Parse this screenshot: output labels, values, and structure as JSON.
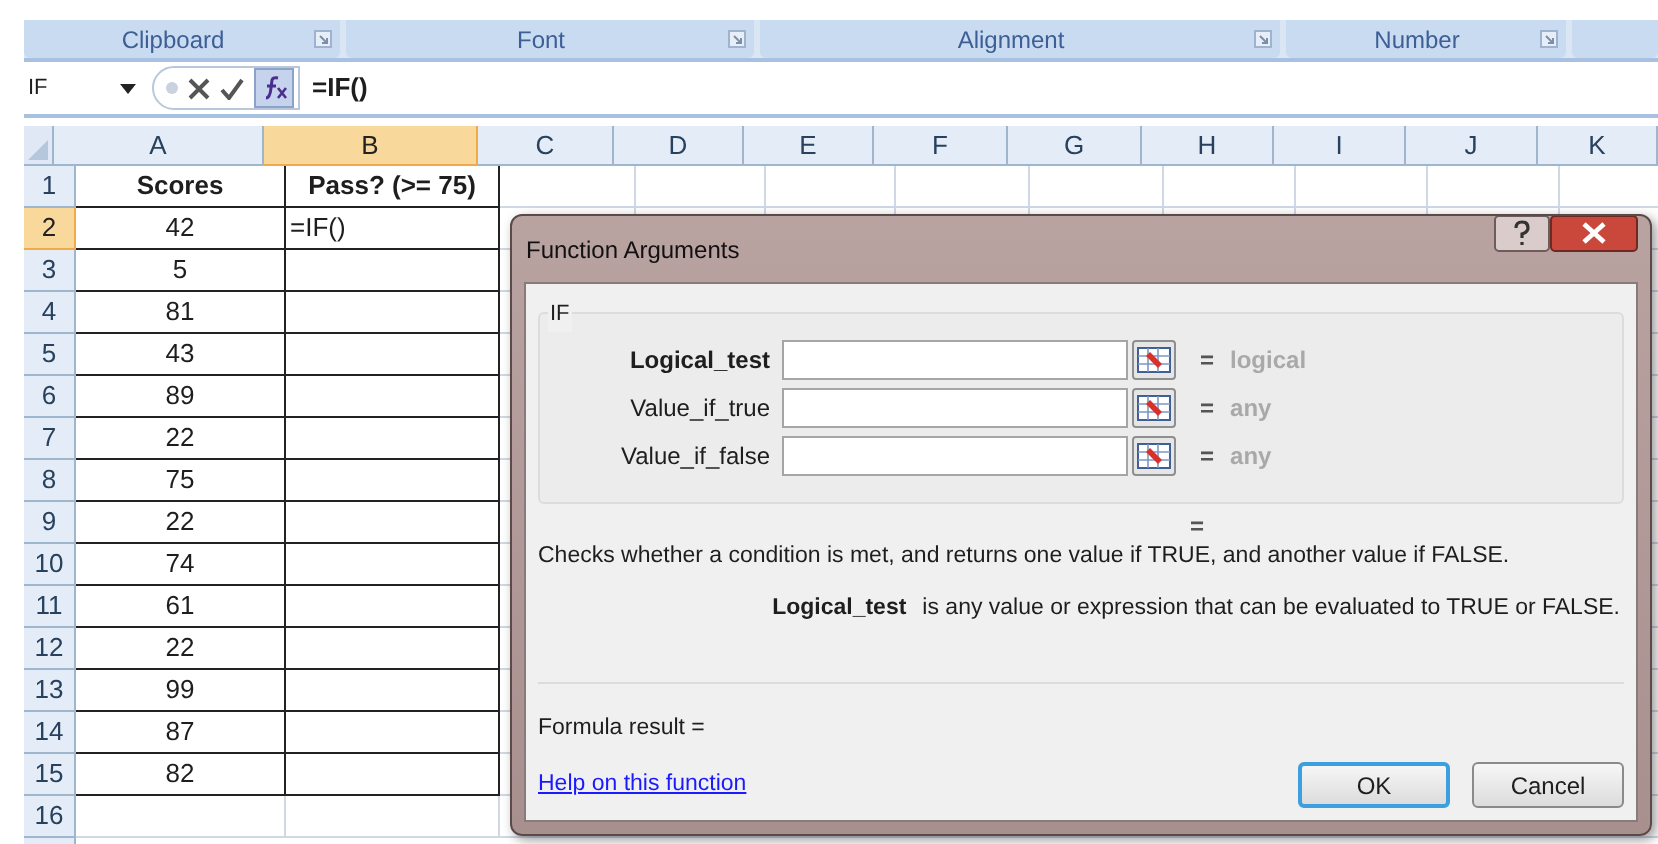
{
  "ribbon_groups": [
    {
      "label": "Clipboard"
    },
    {
      "label": "Font"
    },
    {
      "label": "Alignment"
    },
    {
      "label": "Number"
    }
  ],
  "formula_bar": {
    "name_box": "IF",
    "formula": "=IF()"
  },
  "sheet": {
    "columns": [
      {
        "label": "A",
        "selected": false
      },
      {
        "label": "B",
        "selected": true
      },
      {
        "label": "C",
        "selected": false
      },
      {
        "label": "D",
        "selected": false
      },
      {
        "label": "E",
        "selected": false
      },
      {
        "label": "F",
        "selected": false
      },
      {
        "label": "G",
        "selected": false
      },
      {
        "label": "H",
        "selected": false
      },
      {
        "label": "I",
        "selected": false
      },
      {
        "label": "J",
        "selected": false
      },
      {
        "label": "K",
        "selected": false
      }
    ],
    "rows": [
      {
        "number": "1",
        "selected": false,
        "cells": [
          "Scores",
          "Pass? (>= 75)"
        ]
      },
      {
        "number": "2",
        "selected": true,
        "cells": [
          "42",
          "=IF()"
        ]
      },
      {
        "number": "3",
        "selected": false,
        "cells": [
          "5"
        ]
      },
      {
        "number": "4",
        "selected": false,
        "cells": [
          "81"
        ]
      },
      {
        "number": "5",
        "selected": false,
        "cells": [
          "43"
        ]
      },
      {
        "number": "6",
        "selected": false,
        "cells": [
          "89"
        ]
      },
      {
        "number": "7",
        "selected": false,
        "cells": [
          "22"
        ]
      },
      {
        "number": "8",
        "selected": false,
        "cells": [
          "75"
        ]
      },
      {
        "number": "9",
        "selected": false,
        "cells": [
          "22"
        ]
      },
      {
        "number": "10",
        "selected": false,
        "cells": [
          "74"
        ]
      },
      {
        "number": "11",
        "selected": false,
        "cells": [
          "61"
        ]
      },
      {
        "number": "12",
        "selected": false,
        "cells": [
          "22"
        ]
      },
      {
        "number": "13",
        "selected": false,
        "cells": [
          "99"
        ]
      },
      {
        "number": "14",
        "selected": false,
        "cells": [
          "87"
        ]
      },
      {
        "number": "15",
        "selected": false,
        "cells": [
          "82"
        ]
      },
      {
        "number": "16",
        "selected": false,
        "cells": []
      }
    ]
  },
  "dialog": {
    "title": "Function Arguments",
    "function_name": "IF",
    "arguments": [
      {
        "label": "Logical_test",
        "selected": true,
        "equals": "=",
        "hint": "logical"
      },
      {
        "label": "Value_if_true",
        "selected": false,
        "equals": "=",
        "hint": "any"
      },
      {
        "label": "Value_if_false",
        "selected": false,
        "equals": "=",
        "hint": "any"
      }
    ],
    "result_equals": "=",
    "description": "Checks whether a condition is met, and returns one value if TRUE, and another value if FALSE.",
    "argument_help": {
      "name": "Logical_test",
      "text": "is any value or expression that can be evaluated to TRUE or FALSE."
    },
    "formula_result": "Formula result =",
    "help_link": "Help on this function",
    "buttons": [
      {
        "label": "OK",
        "selected": true
      },
      {
        "label": "Cancel",
        "selected": false
      }
    ]
  }
}
